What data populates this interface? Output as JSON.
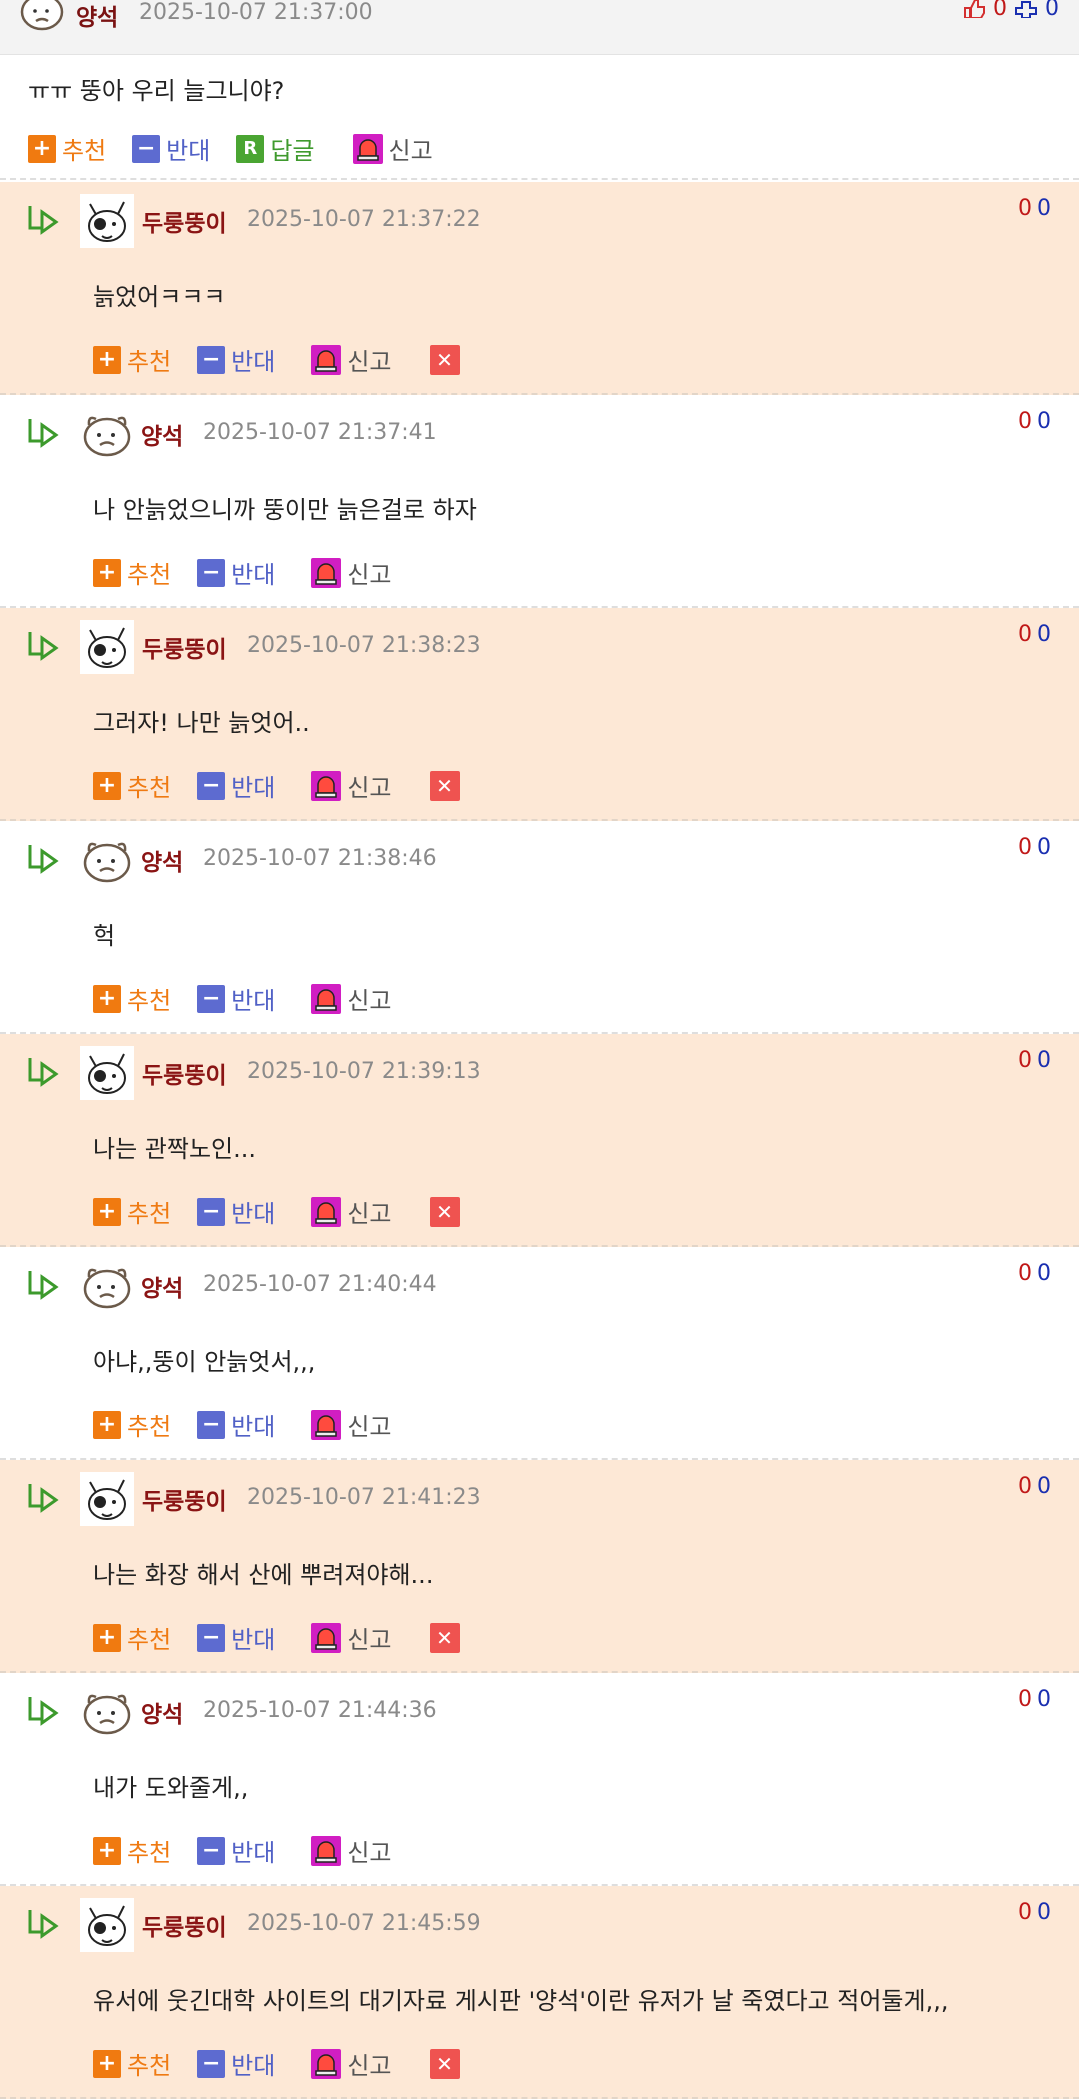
{
  "post": {
    "nick": "양석",
    "time": "2025-10-07 21:37:00",
    "votes_up": "0",
    "votes_down": "0",
    "message": "ㅠㅠ 뚱아 우리 늘그니야?",
    "actions": {
      "recommend": "추천",
      "oppose": "반대",
      "reply": "답글",
      "reply_icon": "R",
      "report": "신고"
    }
  },
  "replies": [
    {
      "nick": "두룽뚱이",
      "time": "2025-10-07 21:37:22",
      "message": "늙었어ㅋㅋㅋ",
      "up": "0",
      "down": "0",
      "avatar": "cat-avatar",
      "bg": "peach",
      "deletable": true
    },
    {
      "nick": "양석",
      "time": "2025-10-07 21:37:41",
      "message": "나 안늙었으니까 뚱이만 늙은걸로 하자",
      "up": "0",
      "down": "0",
      "avatar": "bear-avatar",
      "bg": "white",
      "deletable": false
    },
    {
      "nick": "두룽뚱이",
      "time": "2025-10-07 21:38:23",
      "message": "그러자! 나만 늙엇어..",
      "up": "0",
      "down": "0",
      "avatar": "cat-avatar",
      "bg": "peach",
      "deletable": true
    },
    {
      "nick": "양석",
      "time": "2025-10-07 21:38:46",
      "message": "헉",
      "up": "0",
      "down": "0",
      "avatar": "bear-avatar",
      "bg": "white",
      "deletable": false
    },
    {
      "nick": "두룽뚱이",
      "time": "2025-10-07 21:39:13",
      "message": "나는 관짝노인...",
      "up": "0",
      "down": "0",
      "avatar": "cat-avatar",
      "bg": "peach",
      "deletable": true
    },
    {
      "nick": "양석",
      "time": "2025-10-07 21:40:44",
      "message": "아냐,,뚱이 안늙엇서,,,",
      "up": "0",
      "down": "0",
      "avatar": "bear-avatar",
      "bg": "white",
      "deletable": false
    },
    {
      "nick": "두룽뚱이",
      "time": "2025-10-07 21:41:23",
      "message": "나는 화장 해서 산에 뿌려져야해...",
      "up": "0",
      "down": "0",
      "avatar": "cat-avatar",
      "bg": "peach",
      "deletable": true
    },
    {
      "nick": "양석",
      "time": "2025-10-07 21:44:36",
      "message": "내가 도와줄게,,",
      "up": "0",
      "down": "0",
      "avatar": "bear-avatar",
      "bg": "white",
      "deletable": false
    },
    {
      "nick": "두룽뚱이",
      "time": "2025-10-07 21:45:59",
      "message": "유서에 웃긴대학 사이트의 대기자료 게시판 '양석'이란 유저가 날 죽였다고 적어둘게,,,",
      "up": "0",
      "down": "0",
      "avatar": "cat-avatar",
      "bg": "peach",
      "deletable": true
    }
  ],
  "labels": {
    "recommend": "추천",
    "oppose": "반대",
    "report": "신고",
    "plus": "+",
    "minus": "−",
    "delete": "✕"
  },
  "colors": {
    "peach_bg": "#fde8d6",
    "nick": "#8a1414",
    "recommend": "#ef7a12",
    "oppose": "#5161c6",
    "reply": "#3f9a2e",
    "report_icon": "#d11ec2",
    "delete": "#ef5350"
  }
}
